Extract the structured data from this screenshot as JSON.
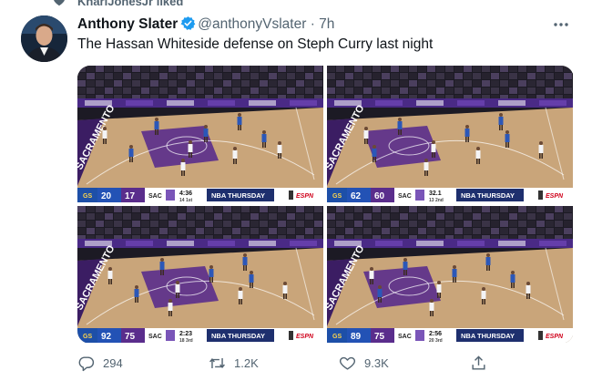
{
  "liked_by": {
    "text": "KhariJonesJr liked"
  },
  "tweet": {
    "author_name": "Anthony Slater",
    "handle": "@anthonyVslater",
    "separator": "·",
    "time": "7h",
    "text": "The Hassan Whiteside defense on Steph Curry last night"
  },
  "frames": [
    {
      "away_team": "GS",
      "away_score": "20",
      "home_score": "17",
      "home_team": "SAC",
      "clock": "4:36",
      "period": "1st",
      "shot_clock": "14",
      "banner": "NBA THURSDAY",
      "network": "ESPN",
      "court_text": "SACRAMENTO"
    },
    {
      "away_team": "GS",
      "away_score": "62",
      "home_score": "60",
      "home_team": "SAC",
      "clock": "32.1",
      "period": "2nd",
      "shot_clock": "13",
      "banner": "NBA THURSDAY",
      "network": "ESPN",
      "court_text": "SACRAMENTO"
    },
    {
      "away_team": "GS",
      "away_score": "92",
      "home_score": "75",
      "home_team": "SAC",
      "clock": "2:23",
      "period": "3rd",
      "shot_clock": "18",
      "banner": "NBA THURSDAY",
      "network": "ESPN",
      "court_text": "SACRAMENTO"
    },
    {
      "away_team": "GS",
      "away_score": "89",
      "home_score": "75",
      "home_team": "SAC",
      "clock": "2:56",
      "period": "3rd",
      "shot_clock": "20",
      "banner": "NBA THURSDAY",
      "network": "ESPN",
      "court_text": "SACRAMENTO"
    }
  ],
  "actions": {
    "replies": "294",
    "retweets": "1.2K",
    "likes": "9.3K"
  },
  "colors": {
    "accent": "#1d9bf0",
    "secondary_text": "#536471",
    "court_purple": "#5a2d8c",
    "court_wood": "#c9a57a",
    "scorebar": "#ffffff"
  },
  "icons": {
    "liked": "heart-icon",
    "verified": "verified-badge-icon",
    "more": "more-icon",
    "reply": "reply-icon",
    "retweet": "retweet-icon",
    "like": "like-icon",
    "share": "share-icon"
  }
}
